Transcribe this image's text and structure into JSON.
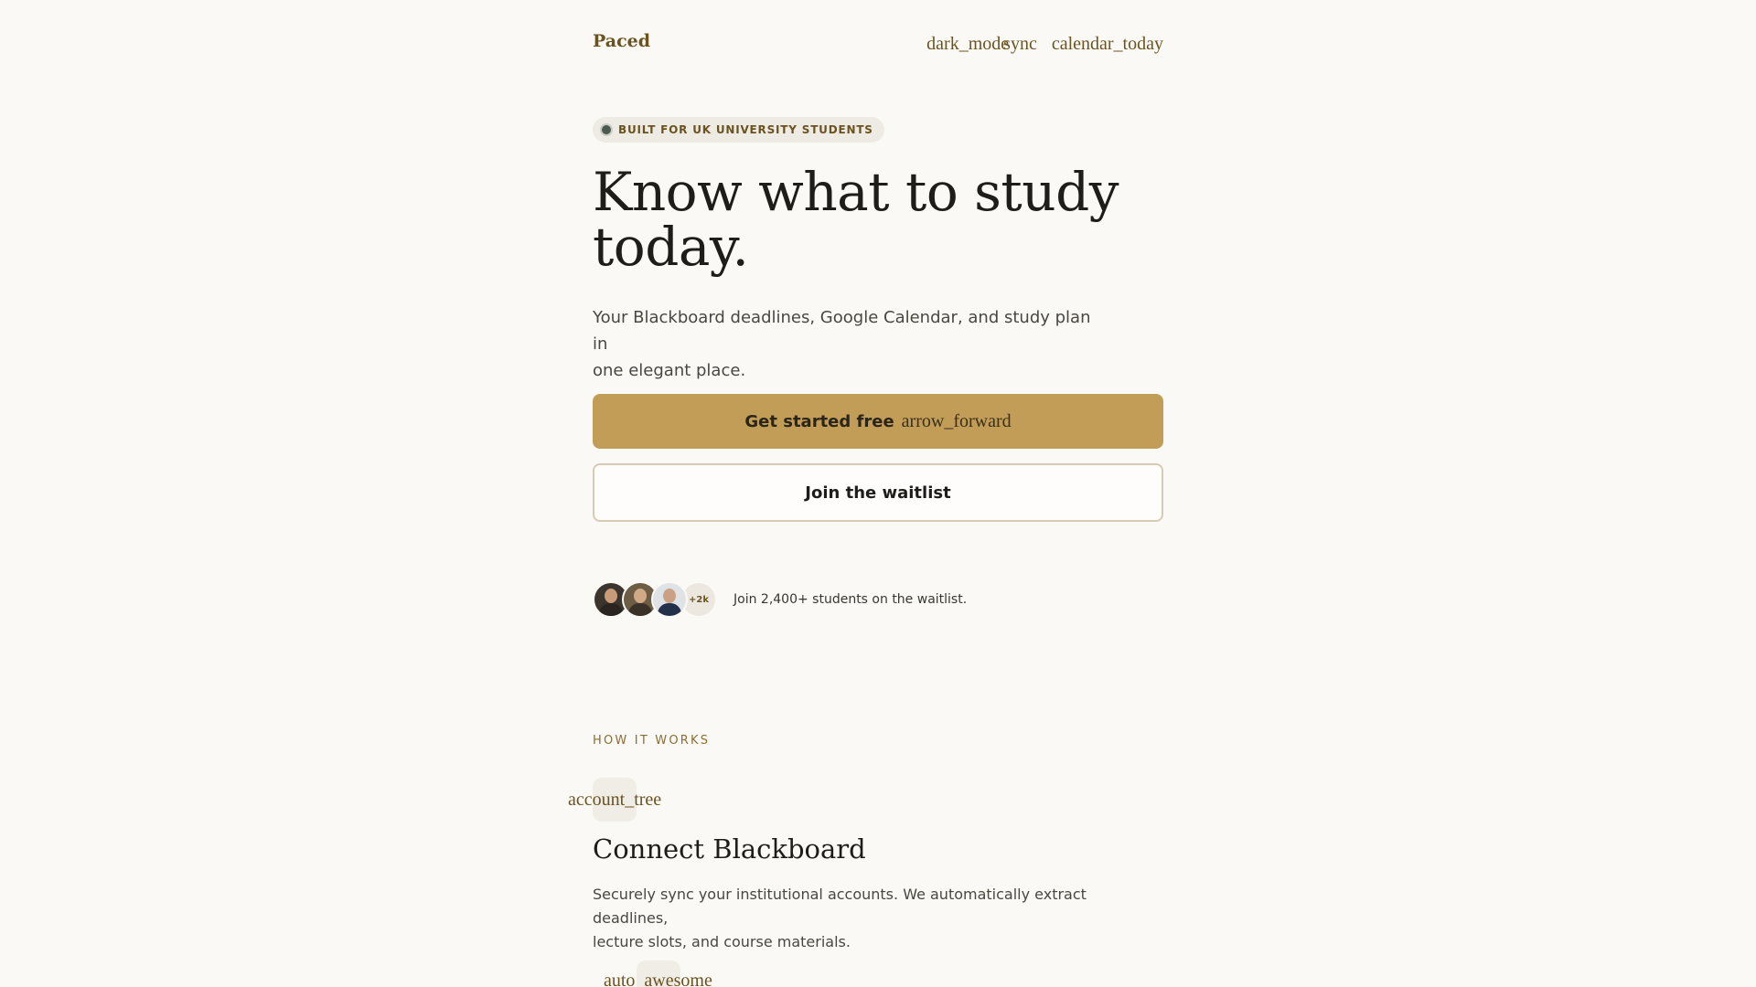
{
  "header": {
    "logo": "Paced",
    "icon_dark_mode": "dark_mode",
    "icon_sync": "sync",
    "icon_calendar": "calendar_today"
  },
  "hero": {
    "badge": "BUILT FOR UK UNIVERSITY STUDENTS",
    "headline_line1": "Know what to study",
    "headline_line2": "today.",
    "subtitle_line1": "Your Blackboard deadlines, Google Calendar, and study plan in",
    "subtitle_line2": "one elegant place.",
    "primary_label": "Get started free",
    "primary_icon": "arrow_forward",
    "secondary_label": "Join the waitlist"
  },
  "social_proof": {
    "more_count": "+2k",
    "text": "Join 2,400+ students on the waitlist."
  },
  "how_it_works": {
    "label": "HOW IT WORKS",
    "steps": [
      {
        "icon": "account_tree",
        "title": "Connect Blackboard",
        "desc_line1": "Securely sync your institutional accounts. We automatically extract deadlines,",
        "desc_line2": "lecture slots, and course materials."
      },
      {
        "icon": "auto_awesome"
      }
    ]
  },
  "colors": {
    "background": "#fbf9f5",
    "accent": "#c19d58",
    "brand_text": "#6b5320"
  }
}
